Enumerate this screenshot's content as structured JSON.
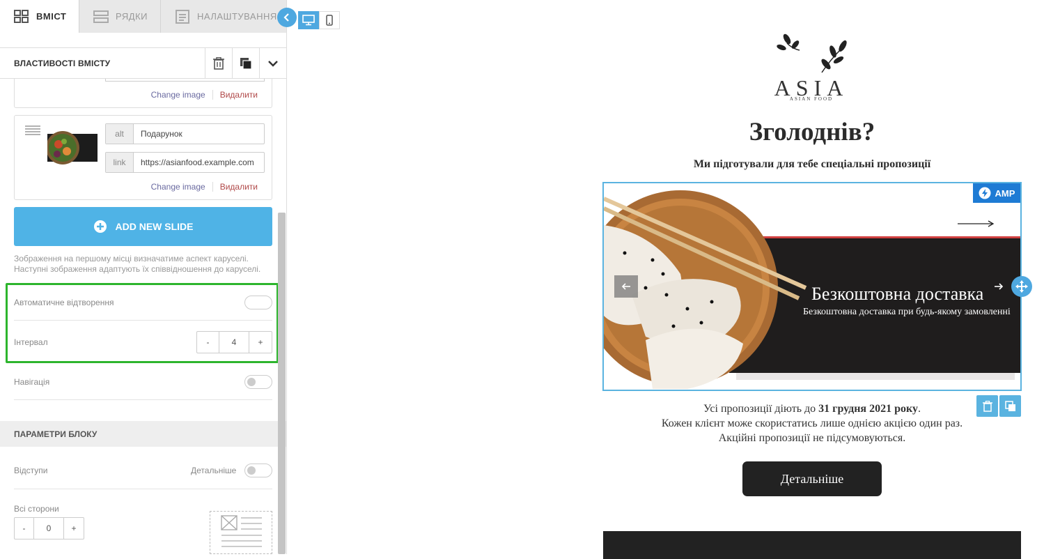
{
  "tabs": [
    {
      "label": "Вміст",
      "icon": "grid-icon",
      "active": true
    },
    {
      "label": "Рядки",
      "icon": "rows-icon",
      "active": false
    },
    {
      "label": "Налаштування",
      "icon": "settings-doc-icon",
      "active": false
    }
  ],
  "props": {
    "title": "Властивості вмісту"
  },
  "slides": [
    {
      "change_label": "Change image",
      "delete_label": "Видалити"
    },
    {
      "alt_label": "alt",
      "alt_value": "Подарунок",
      "link_label": "link",
      "link_value": "https://asianfood.example.com",
      "change_label": "Change image",
      "delete_label": "Видалити"
    }
  ],
  "add_slide_label": "ADD NEW SLIDE",
  "hint": "Зображення на першому місці визначатиме аспект каруселі. Наступні зображення адаптують їх співвідношення до каруселі.",
  "autoplay": {
    "label": "Автоматичне відтворення",
    "enabled": false
  },
  "interval": {
    "label": "Інтервал",
    "minus": "-",
    "value": "4",
    "plus": "+"
  },
  "navigation": {
    "label": "Навігація",
    "enabled": false
  },
  "block_params": {
    "title": "Параметри блоку"
  },
  "padding": {
    "label": "Відступи",
    "detail_label": "Детальніше"
  },
  "all_sides": {
    "label": "Всі сторони",
    "minus": "-",
    "value": "0",
    "plus": "+"
  },
  "email": {
    "logo_text": "ASIA",
    "logo_subtext": "ASIAN FOOD",
    "title": "Зголоднів?",
    "subtitle": "Ми підготували для тебе спеціальні пропозиції",
    "amp_badge": "AMP",
    "slide_title": "Безкоштовна доставка",
    "slide_subtitle": "Безкоштовна доставка при будь-якому замовленні",
    "note_prefix": "Усі пропозиції діють до ",
    "note_date": "31 грудня 2021 року",
    "note_suffix": ".",
    "note_line2": "Кожен клієнт може скористатись лише однією акцією один раз.",
    "note_line3": "Акційні пропозиції не підсумовуються.",
    "cta_label": "Детальніше"
  },
  "colors": {
    "accent_blue": "#4fb3e6",
    "highlight_green": "#2db52d",
    "amp_blue": "#1e7bd4",
    "dark": "#222222"
  }
}
